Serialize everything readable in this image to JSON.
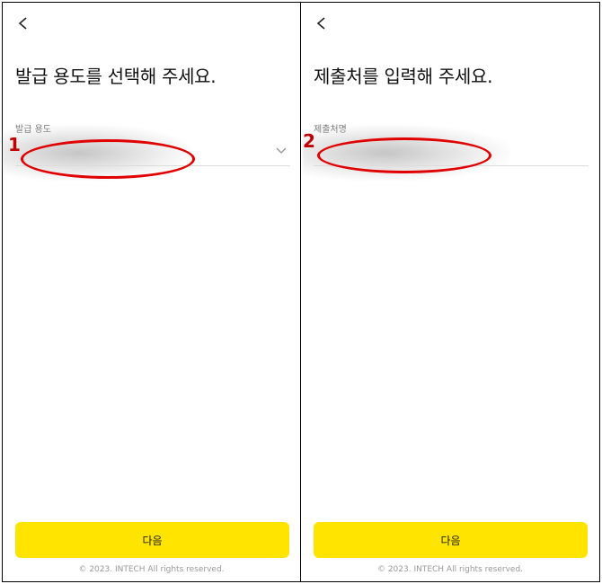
{
  "screens": [
    {
      "title": "발급 용도를 선택해 주세요.",
      "field_label": "발급 용도",
      "field_value": "",
      "annotation_number": "1",
      "next_label": "다음",
      "footer": "© 2023. INTECH All rights reserved."
    },
    {
      "title": "제출처를 입력해 주세요.",
      "field_label": "제출처명",
      "field_value": "",
      "annotation_number": "2",
      "next_label": "다음",
      "footer": "© 2023. INTECH All rights reserved."
    }
  ],
  "icons": {
    "back": "chevron-left-icon",
    "dropdown": "chevron-down-icon"
  },
  "colors": {
    "primary_button": "#ffe400",
    "annotation": "#e00000"
  }
}
